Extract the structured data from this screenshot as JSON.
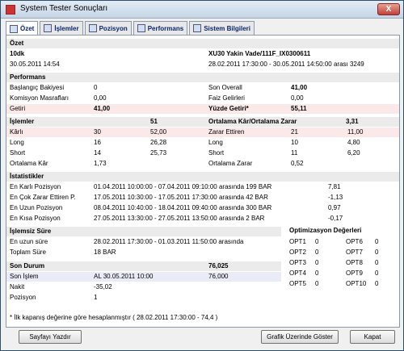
{
  "window": {
    "title": "System Tester Sonuçları",
    "close": "X"
  },
  "tabs": [
    "Özet",
    "İşlemler",
    "Pozisyon",
    "Performans",
    "Sistem Bilgileri"
  ],
  "summary": {
    "header": "Özet",
    "period": "10dk",
    "symbol": "XU30 Yakin Vade/111F_IX0300611",
    "date": "30.05.2011 14:54",
    "range": "28.02.2011 17:30:00 - 30.05.2011 14:50:00 arası 3249"
  },
  "performance": {
    "header": "Performans",
    "left": [
      {
        "label": "Başlangıç Bakiyesi",
        "value": "0"
      },
      {
        "label": "Komisyon Masrafları",
        "value": "0,00"
      },
      {
        "label": "Getiri",
        "value": "41,00"
      }
    ],
    "right": [
      {
        "label": "Son Overall",
        "value": "41,00"
      },
      {
        "label": "Faiz Gelirleri",
        "value": "0,00"
      },
      {
        "label": "Yüzde Getiri*",
        "value": "55,11"
      }
    ]
  },
  "trades": {
    "header": "İşlemler",
    "header_count": "51",
    "avg_header": "Ortalama Kâr/Ortalama Zarar",
    "avg_value": "3,31",
    "left": [
      {
        "label": "Kârlı",
        "count": "30",
        "value": "52,00"
      },
      {
        "label": "Long",
        "count": "16",
        "value": "26,28"
      },
      {
        "label": "Short",
        "count": "14",
        "value": "25,73"
      },
      {
        "label": "Ortalama Kâr",
        "count": "1,73",
        "value": ""
      }
    ],
    "right": [
      {
        "label": "Zarar Ettiren",
        "count": "21",
        "value": "11,00"
      },
      {
        "label": "Long",
        "count": "10",
        "value": "4,80"
      },
      {
        "label": "Short",
        "count": "11",
        "value": "6,20"
      },
      {
        "label": "Ortalama Zarar",
        "count": "0,52",
        "value": ""
      }
    ]
  },
  "stats": {
    "header": "İstatistikler",
    "rows": [
      {
        "label": "En Karlı Pozisyon",
        "range": "01.04.2011 10:00:00 - 07.04.2011 09:10:00 arasında 199 BAR",
        "value": "7,81"
      },
      {
        "label": "En Çok Zarar Ettiren P.",
        "range": "17.05.2011 10:30:00 - 17.05.2011 17:30:00 arasında 42 BAR",
        "value": "-1,13"
      },
      {
        "label": "En Uzun Pozisyon",
        "range": "08.04.2011 10:40:00 - 18.04.2011 09:40:00 arasında 300 BAR",
        "value": "0,97"
      },
      {
        "label": "En Kısa Pozisyon",
        "range": "27.05.2011 13:30:00 - 27.05.2011 13:50:00 arasında 2 BAR",
        "value": "-0,17"
      }
    ]
  },
  "idle": {
    "header": "İşlemsiz Süre",
    "rows": [
      {
        "label": "En uzun süre",
        "value": "28.02.2011 17:30:00 - 01.03.2011 11:50:00 arasında"
      },
      {
        "label": "Toplam Süre",
        "value": "18 BAR"
      }
    ]
  },
  "optimization": {
    "header": "Optimizasyon Değerleri",
    "left": [
      {
        "label": "OPT1",
        "value": "0"
      },
      {
        "label": "OPT2",
        "value": "0"
      },
      {
        "label": "OPT3",
        "value": "0"
      },
      {
        "label": "OPT4",
        "value": "0"
      },
      {
        "label": "OPT5",
        "value": "0"
      }
    ],
    "right": [
      {
        "label": "OPT6",
        "value": "0"
      },
      {
        "label": "OPT7",
        "value": "0"
      },
      {
        "label": "OPT8",
        "value": "0"
      },
      {
        "label": "OPT9",
        "value": "0"
      },
      {
        "label": "OPT10",
        "value": "0"
      }
    ]
  },
  "last": {
    "header": "Son Durum",
    "header_value": "76,025",
    "rows": [
      {
        "label": "Son İşlem",
        "value": "AL  30.05.2011 10:00",
        "extra": "76,000"
      },
      {
        "label": "Nakit",
        "value": "-35,02",
        "extra": ""
      },
      {
        "label": "Pozisyon",
        "value": "1",
        "extra": ""
      }
    ]
  },
  "footnote": "* İlk kapanış değerine göre hesaplanmıştır ( 28.02.2011 17:30:00 - 74,4 )",
  "buttons": {
    "print": "Sayfayı Yazdır",
    "chart": "Grafik Üzerinde Göster",
    "close": "Kapat"
  }
}
